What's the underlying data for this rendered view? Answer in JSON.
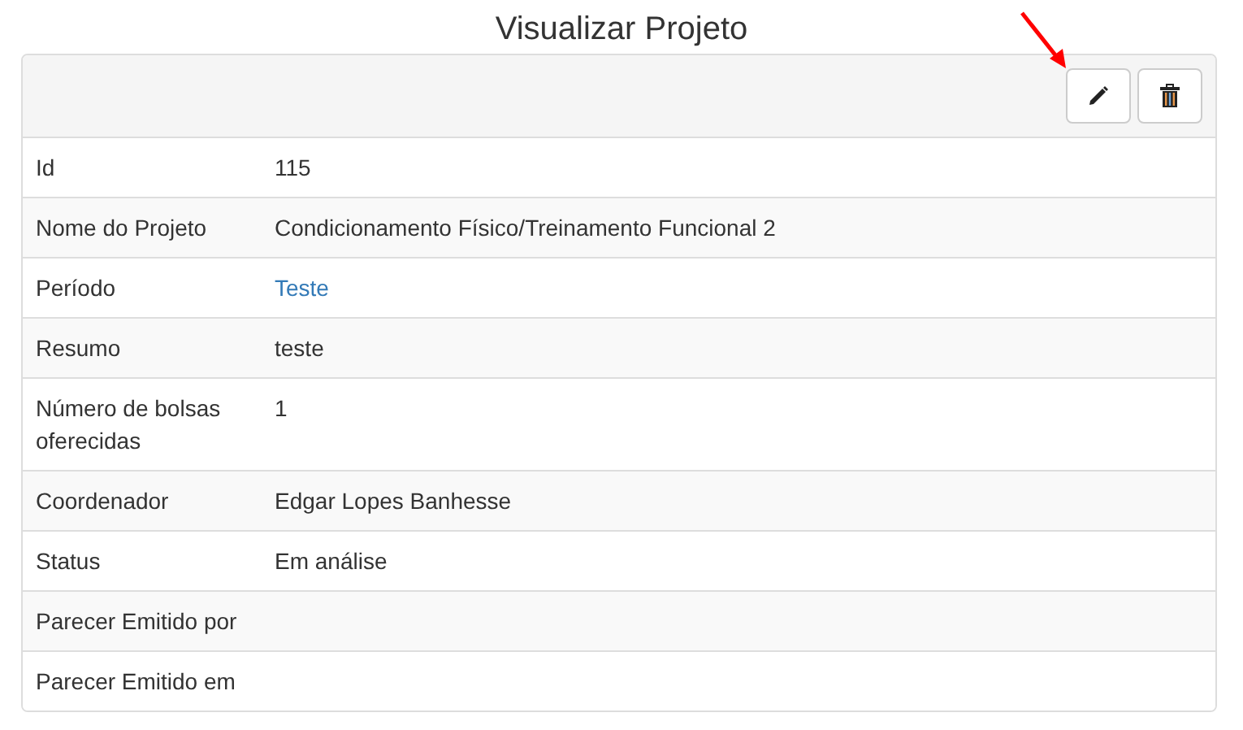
{
  "page_title": "Visualizar Projeto",
  "toolbar": {
    "buttons": [
      {
        "kind": "edit"
      },
      {
        "kind": "delete"
      }
    ]
  },
  "annotation": {
    "kind": "arrow"
  },
  "fields": [
    {
      "label": "Id",
      "value": "115"
    },
    {
      "label": "Nome do Projeto",
      "value": "Condicionamento Físico/Treinamento Funcional 2"
    },
    {
      "label": "Período",
      "value": "Teste",
      "kind": "link"
    },
    {
      "label": "Resumo",
      "value": "teste"
    },
    {
      "label": "Número de bolsas oferecidas",
      "value": "1"
    },
    {
      "label": "Coordenador",
      "value": "Edgar Lopes Banhesse"
    },
    {
      "label": "Status",
      "value": "Em análise"
    },
    {
      "label": "Parecer Emitido por"
    },
    {
      "label": "Parecer Emitido em"
    }
  ]
}
